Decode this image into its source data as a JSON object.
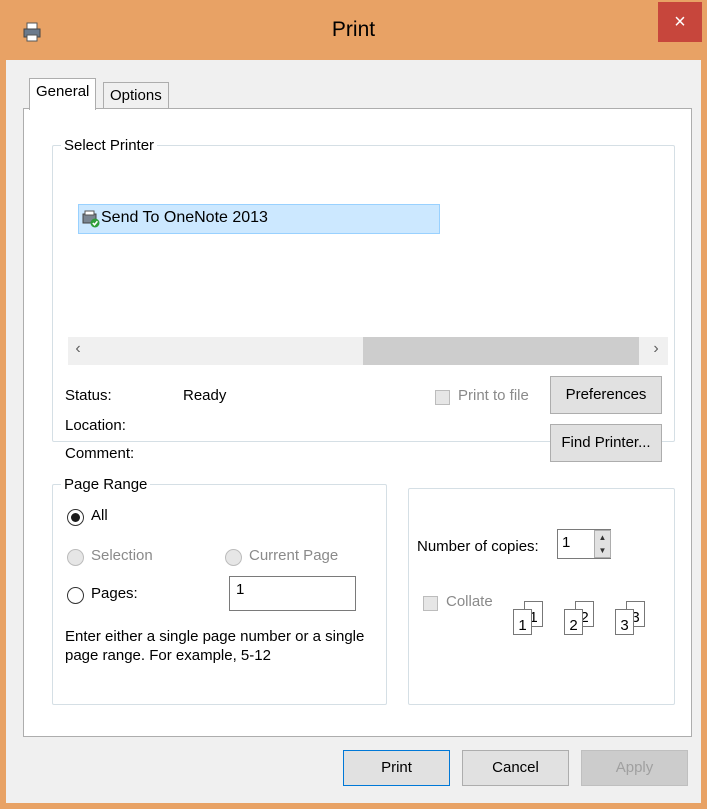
{
  "window": {
    "title": "Print",
    "close_glyph": "×",
    "icon": "printer-icon"
  },
  "tabs": [
    {
      "label": "General",
      "active": true
    },
    {
      "label": "Options",
      "active": false
    }
  ],
  "select_printer": {
    "legend": "Select Printer",
    "printers": [
      {
        "name": "Send To OneNote 2013",
        "selected": true
      }
    ],
    "scroll_left": "‹",
    "scroll_right": "›",
    "status_label": "Status:",
    "status_value": "Ready",
    "location_label": "Location:",
    "location_value": "",
    "comment_label": "Comment:",
    "comment_value": "",
    "print_to_file_label": "Print to file",
    "print_to_file_checked": false,
    "preferences_label": "Preferences",
    "find_printer_label": "Find Printer..."
  },
  "page_range": {
    "legend": "Page Range",
    "all_label": "All",
    "selection_label": "Selection",
    "current_page_label": "Current Page",
    "pages_label": "Pages:",
    "pages_value": "1",
    "selected": "All",
    "hint": "Enter either a single page number or a single page range.  For example, 5-12"
  },
  "copies": {
    "label": "Number of copies:",
    "value": "1",
    "collate_label": "Collate",
    "collate_checked": false,
    "collate_pages": [
      "1",
      "1",
      "2",
      "2",
      "3",
      "3"
    ]
  },
  "buttons": {
    "print": "Print",
    "cancel": "Cancel",
    "apply": "Apply"
  },
  "colors": {
    "title_bar": "#e8a265",
    "close_button": "#c7463c",
    "selection_highlight": "#cce8ff",
    "default_button_border": "#0078d7"
  }
}
